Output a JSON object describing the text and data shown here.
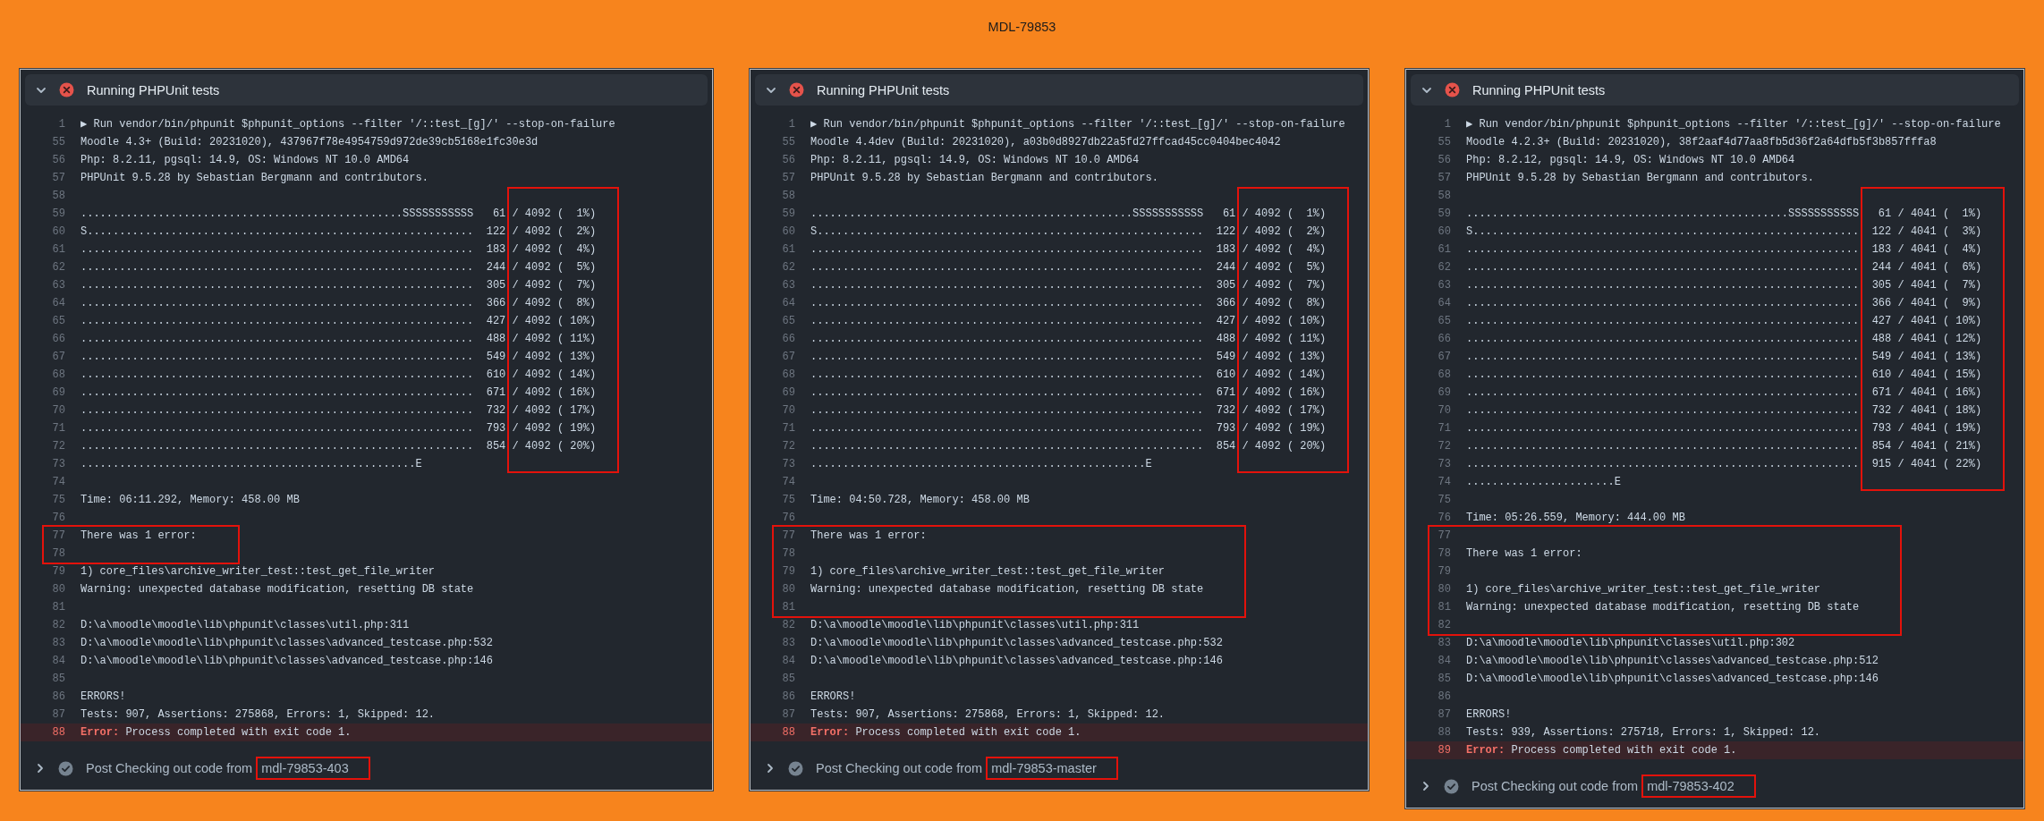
{
  "title": "MDL-79853",
  "panels": [
    {
      "header": {
        "label": "Running PHPUnit tests",
        "expanded": true,
        "failed": true
      },
      "lines": [
        {
          "kind": "line",
          "number": "1",
          "text": "▶ Run vendor/bin/phpunit $phpunit_options --filter '/::test_[g]/' --stop-on-failure"
        },
        {
          "kind": "line",
          "number": "55",
          "text": "Moodle 4.3+ (Build: 20231020), 437967f78e4954759d972de39cb5168e1fc30e3d"
        },
        {
          "kind": "line",
          "number": "56",
          "text": "Php: 8.2.11, pgsql: 14.9, OS: Windows NT 10.0 AMD64"
        },
        {
          "kind": "line",
          "number": "57",
          "text": "PHPUnit 9.5.28 by Sebastian Bergmann and contributors."
        },
        {
          "kind": "line",
          "number": "58"
        },
        {
          "kind": "progress_box",
          "lines": [
            {
              "number": "59",
              "text": "..................................................SSSSSSSSSSS   61",
              "progress": "/ 4092 (  1%)"
            },
            {
              "number": "60",
              "text": "S............................................................  122",
              "progress": "/ 4092 (  2%)"
            },
            {
              "number": "61",
              "text": ".............................................................  183",
              "progress": "/ 4092 (  4%)"
            },
            {
              "number": "62",
              "text": ".............................................................  244",
              "progress": "/ 4092 (  5%)"
            },
            {
              "number": "63",
              "text": ".............................................................  305",
              "progress": "/ 4092 (  7%)"
            },
            {
              "number": "64",
              "text": ".............................................................  366",
              "progress": "/ 4092 (  8%)"
            },
            {
              "number": "65",
              "text": ".............................................................  427",
              "progress": "/ 4092 ( 10%)"
            },
            {
              "number": "66",
              "text": ".............................................................  488",
              "progress": "/ 4092 ( 11%)"
            },
            {
              "number": "67",
              "text": ".............................................................  549",
              "progress": "/ 4092 ( 13%)"
            },
            {
              "number": "68",
              "text": ".............................................................  610",
              "progress": "/ 4092 ( 14%)"
            },
            {
              "number": "69",
              "text": ".............................................................  671",
              "progress": "/ 4092 ( 16%)"
            },
            {
              "number": "70",
              "text": ".............................................................  732",
              "progress": "/ 4092 ( 17%)"
            },
            {
              "number": "71",
              "text": ".............................................................  793",
              "progress": "/ 4092 ( 19%)"
            },
            {
              "number": "72",
              "text": ".............................................................  854",
              "progress": "/ 4092 ( 20%)"
            }
          ]
        },
        {
          "kind": "line",
          "number": "73",
          "text": "....................................................E"
        },
        {
          "kind": "line",
          "number": "74"
        },
        {
          "kind": "line",
          "number": "75",
          "text": "Time: 06:11.292, Memory: 458.00 MB"
        },
        {
          "kind": "line",
          "number": "76"
        },
        {
          "kind": "box",
          "lines": [
            {
              "number": "77",
              "text": "There was 1 error:"
            },
            {
              "number": "78"
            }
          ]
        },
        {
          "kind": "line",
          "number": "79",
          "text": "1) core_files\\archive_writer_test::test_get_file_writer"
        },
        {
          "kind": "line",
          "number": "80",
          "text": "Warning: unexpected database modification, resetting DB state"
        },
        {
          "kind": "line",
          "number": "81"
        },
        {
          "kind": "line",
          "number": "82",
          "text": "D:\\a\\moodle\\moodle\\lib\\phpunit\\classes\\util.php:311"
        },
        {
          "kind": "line",
          "number": "83",
          "text": "D:\\a\\moodle\\moodle\\lib\\phpunit\\classes\\advanced_testcase.php:532"
        },
        {
          "kind": "line",
          "number": "84",
          "text": "D:\\a\\moodle\\moodle\\lib\\phpunit\\classes\\advanced_testcase.php:146"
        },
        {
          "kind": "line",
          "number": "85"
        },
        {
          "kind": "line",
          "number": "86",
          "text": "ERRORS!"
        },
        {
          "kind": "line",
          "number": "87",
          "text": "Tests: 907, Assertions: 275868, Errors: 1, Skipped: 12."
        },
        {
          "kind": "error",
          "number": "88",
          "label": "Error:",
          "text": "Process completed with exit code 1."
        }
      ],
      "footer": {
        "label": "Post Checking out code from",
        "branch": "mdl-79853-403",
        "branch_boxed": true,
        "expanded": false,
        "failed": false
      }
    },
    {
      "header": {
        "label": "Running PHPUnit tests",
        "expanded": true,
        "failed": true
      },
      "lines": [
        {
          "kind": "line",
          "number": "1",
          "text": "▶ Run vendor/bin/phpunit $phpunit_options --filter '/::test_[g]/' --stop-on-failure"
        },
        {
          "kind": "line",
          "number": "55",
          "text": "Moodle 4.4dev (Build: 20231020), a03b0d8927db22a5fd27ffcad45cc0404bec4042"
        },
        {
          "kind": "line",
          "number": "56",
          "text": "Php: 8.2.11, pgsql: 14.9, OS: Windows NT 10.0 AMD64"
        },
        {
          "kind": "line",
          "number": "57",
          "text": "PHPUnit 9.5.28 by Sebastian Bergmann and contributors."
        },
        {
          "kind": "line",
          "number": "58"
        },
        {
          "kind": "progress_box",
          "lines": [
            {
              "number": "59",
              "text": "..................................................SSSSSSSSSSS   61",
              "progress": "/ 4092 (  1%)"
            },
            {
              "number": "60",
              "text": "S............................................................  122",
              "progress": "/ 4092 (  2%)"
            },
            {
              "number": "61",
              "text": ".............................................................  183",
              "progress": "/ 4092 (  4%)"
            },
            {
              "number": "62",
              "text": ".............................................................  244",
              "progress": "/ 4092 (  5%)"
            },
            {
              "number": "63",
              "text": ".............................................................  305",
              "progress": "/ 4092 (  7%)"
            },
            {
              "number": "64",
              "text": ".............................................................  366",
              "progress": "/ 4092 (  8%)"
            },
            {
              "number": "65",
              "text": ".............................................................  427",
              "progress": "/ 4092 ( 10%)"
            },
            {
              "number": "66",
              "text": ".............................................................  488",
              "progress": "/ 4092 ( 11%)"
            },
            {
              "number": "67",
              "text": ".............................................................  549",
              "progress": "/ 4092 ( 13%)"
            },
            {
              "number": "68",
              "text": ".............................................................  610",
              "progress": "/ 4092 ( 14%)"
            },
            {
              "number": "69",
              "text": ".............................................................  671",
              "progress": "/ 4092 ( 16%)"
            },
            {
              "number": "70",
              "text": ".............................................................  732",
              "progress": "/ 4092 ( 17%)"
            },
            {
              "number": "71",
              "text": ".............................................................  793",
              "progress": "/ 4092 ( 19%)"
            },
            {
              "number": "72",
              "text": ".............................................................  854",
              "progress": "/ 4092 ( 20%)"
            }
          ]
        },
        {
          "kind": "line",
          "number": "73",
          "text": "....................................................E"
        },
        {
          "kind": "line",
          "number": "74"
        },
        {
          "kind": "line",
          "number": "75",
          "text": "Time: 04:50.728, Memory: 458.00 MB"
        },
        {
          "kind": "line",
          "number": "76"
        },
        {
          "kind": "box",
          "lines": [
            {
              "number": "77",
              "text": "There was 1 error:"
            },
            {
              "number": "78"
            },
            {
              "number": "79",
              "text": "1) core_files\\archive_writer_test::test_get_file_writer"
            },
            {
              "number": "80",
              "text": "Warning: unexpected database modification, resetting DB state"
            },
            {
              "number": "81"
            }
          ]
        },
        {
          "kind": "line",
          "number": "82",
          "text": "D:\\a\\moodle\\moodle\\lib\\phpunit\\classes\\util.php:311"
        },
        {
          "kind": "line",
          "number": "83",
          "text": "D:\\a\\moodle\\moodle\\lib\\phpunit\\classes\\advanced_testcase.php:532"
        },
        {
          "kind": "line",
          "number": "84",
          "text": "D:\\a\\moodle\\moodle\\lib\\phpunit\\classes\\advanced_testcase.php:146"
        },
        {
          "kind": "line",
          "number": "85"
        },
        {
          "kind": "line",
          "number": "86",
          "text": "ERRORS!"
        },
        {
          "kind": "line",
          "number": "87",
          "text": "Tests: 907, Assertions: 275868, Errors: 1, Skipped: 12."
        },
        {
          "kind": "error",
          "number": "88",
          "label": "Error:",
          "text": "Process completed with exit code 1."
        }
      ],
      "footer": {
        "label": "Post Checking out code from",
        "branch": "mdl-79853-master",
        "branch_boxed": true,
        "expanded": false,
        "failed": false
      }
    },
    {
      "header": {
        "label": "Running PHPUnit tests",
        "expanded": true,
        "failed": true
      },
      "lines": [
        {
          "kind": "line",
          "number": "1",
          "text": "▶ Run vendor/bin/phpunit $phpunit_options --filter '/::test_[g]/' --stop-on-failure"
        },
        {
          "kind": "line",
          "number": "55",
          "text": "Moodle 4.2.3+ (Build: 20231020), 38f2aaf4d77aa8fb5d36f2a64dfb5f3b857fffa8"
        },
        {
          "kind": "line",
          "number": "56",
          "text": "Php: 8.2.12, pgsql: 14.9, OS: Windows NT 10.0 AMD64"
        },
        {
          "kind": "line",
          "number": "57",
          "text": "PHPUnit 9.5.28 by Sebastian Bergmann and contributors."
        },
        {
          "kind": "line",
          "number": "58"
        },
        {
          "kind": "progress_box",
          "lines": [
            {
              "number": "59",
              "text": "..................................................SSSSSSSSSSS",
              "progress": "  61 / 4041 (  1%)"
            },
            {
              "number": "60",
              "text": "S............................................................",
              "progress": " 122 / 4041 (  3%)"
            },
            {
              "number": "61",
              "text": ".............................................................",
              "progress": " 183 / 4041 (  4%)"
            },
            {
              "number": "62",
              "text": ".............................................................",
              "progress": " 244 / 4041 (  6%)"
            },
            {
              "number": "63",
              "text": ".............................................................",
              "progress": " 305 / 4041 (  7%)"
            },
            {
              "number": "64",
              "text": ".............................................................",
              "progress": " 366 / 4041 (  9%)"
            },
            {
              "number": "65",
              "text": ".............................................................",
              "progress": " 427 / 4041 ( 10%)"
            },
            {
              "number": "66",
              "text": ".............................................................",
              "progress": " 488 / 4041 ( 12%)"
            },
            {
              "number": "67",
              "text": ".............................................................",
              "progress": " 549 / 4041 ( 13%)"
            },
            {
              "number": "68",
              "text": ".............................................................",
              "progress": " 610 / 4041 ( 15%)"
            },
            {
              "number": "69",
              "text": ".............................................................",
              "progress": " 671 / 4041 ( 16%)"
            },
            {
              "number": "70",
              "text": ".............................................................",
              "progress": " 732 / 4041 ( 18%)"
            },
            {
              "number": "71",
              "text": ".............................................................",
              "progress": " 793 / 4041 ( 19%)"
            },
            {
              "number": "72",
              "text": ".............................................................",
              "progress": " 854 / 4041 ( 21%)"
            },
            {
              "number": "73",
              "text": ".............................................................",
              "progress": " 915 / 4041 ( 22%)"
            }
          ]
        },
        {
          "kind": "line",
          "number": "74",
          "text": ".......................E"
        },
        {
          "kind": "line",
          "number": "75"
        },
        {
          "kind": "line",
          "number": "76",
          "text": "Time: 05:26.559, Memory: 444.00 MB"
        },
        {
          "kind": "box",
          "lines": [
            {
              "number": "77"
            },
            {
              "number": "78",
              "text": "There was 1 error:"
            },
            {
              "number": "79"
            },
            {
              "number": "80",
              "text": "1) core_files\\archive_writer_test::test_get_file_writer"
            },
            {
              "number": "81",
              "text": "Warning: unexpected database modification, resetting DB state"
            },
            {
              "number": "82"
            }
          ]
        },
        {
          "kind": "line",
          "number": "83",
          "text": "D:\\a\\moodle\\moodle\\lib\\phpunit\\classes\\util.php:302"
        },
        {
          "kind": "line",
          "number": "84",
          "text": "D:\\a\\moodle\\moodle\\lib\\phpunit\\classes\\advanced_testcase.php:512"
        },
        {
          "kind": "line",
          "number": "85",
          "text": "D:\\a\\moodle\\moodle\\lib\\phpunit\\classes\\advanced_testcase.php:146"
        },
        {
          "kind": "line",
          "number": "86"
        },
        {
          "kind": "line",
          "number": "87",
          "text": "ERRORS!"
        },
        {
          "kind": "line",
          "number": "88",
          "text": "Tests: 939, Assertions: 275718, Errors: 1, Skipped: 12."
        },
        {
          "kind": "error",
          "number": "89",
          "label": "Error:",
          "text": "Process completed with exit code 1."
        }
      ],
      "footer": {
        "label": "Post Checking out code from",
        "branch": "mdl-79853-402",
        "branch_boxed": true,
        "expanded": false,
        "failed": false
      }
    }
  ]
}
